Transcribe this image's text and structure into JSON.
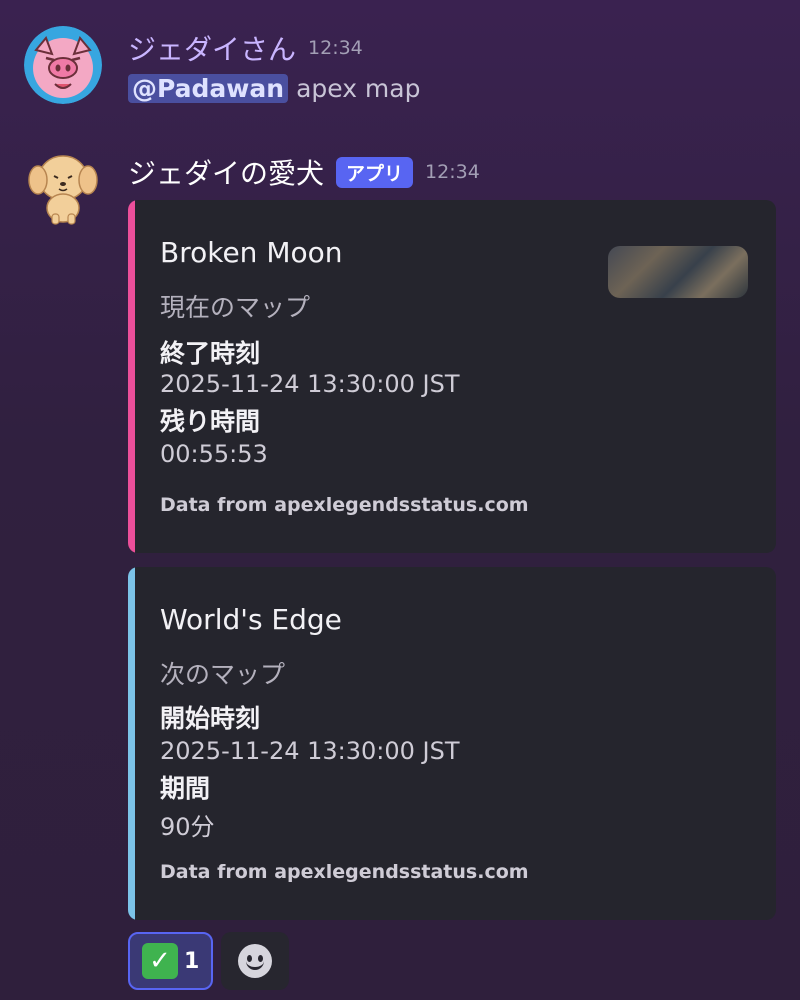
{
  "message1": {
    "username": "ジェダイさん",
    "time": "12:34",
    "mention": "@Padawan",
    "text": "apex map",
    "avatar": "pig-avatar-icon"
  },
  "message2": {
    "username": "ジェダイの愛犬",
    "badge": "アプリ",
    "time": "12:34",
    "avatar": "dog-avatar-icon"
  },
  "embed1": {
    "accent": "#ec4f9a",
    "title": "Broken Moon",
    "description": "現在のマップ",
    "fields": [
      {
        "name": "終了時刻",
        "value": "2025-11-24 13:30:00 JST"
      },
      {
        "name": "残り時間",
        "value": "00:55:53"
      }
    ],
    "footer": "Data from apexlegendsstatus.com"
  },
  "embed2": {
    "accent": "#7cc3e8",
    "title": "World's Edge",
    "description": "次のマップ",
    "fields": [
      {
        "name": "開始時刻",
        "value": "2025-11-24 13:30:00 JST"
      },
      {
        "name": "期間",
        "value": "90分"
      }
    ],
    "footer": "Data from apexlegendsstatus.com"
  },
  "reactions": [
    {
      "emoji": "✅",
      "count": "1",
      "icon": "check-mark-emoji-icon"
    },
    {
      "icon": "add-reaction-icon"
    }
  ]
}
